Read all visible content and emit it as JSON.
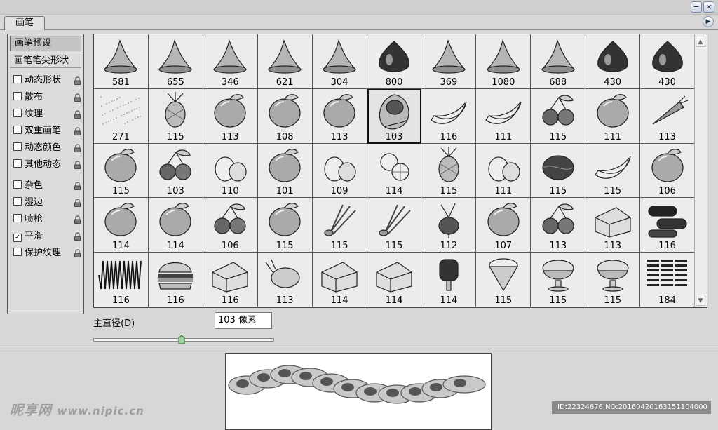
{
  "window": {
    "minimize_label": "−",
    "close_label": "×"
  },
  "tabs": [
    {
      "label": "画笔"
    }
  ],
  "panel_menu_icon": "arrow-right-icon",
  "left_panel": {
    "presets_label": "画笔预设",
    "tip_shape_label": "画笔笔尖形状",
    "options": [
      {
        "label": "动态形状",
        "checked": false,
        "lock": true
      },
      {
        "label": "散布",
        "checked": false,
        "lock": true
      },
      {
        "label": "纹理",
        "checked": false,
        "lock": true
      },
      {
        "label": "双重画笔",
        "checked": false,
        "lock": true
      },
      {
        "label": "动态颜色",
        "checked": false,
        "lock": true
      },
      {
        "label": "其他动态",
        "checked": false,
        "lock": true
      },
      {
        "label": "杂色",
        "checked": false,
        "lock": true
      },
      {
        "label": "湿边",
        "checked": false,
        "lock": true
      },
      {
        "label": "喷枪",
        "checked": false,
        "lock": true
      },
      {
        "label": "平滑",
        "checked": true,
        "lock": true
      },
      {
        "label": "保护纹理",
        "checked": false,
        "lock": true
      }
    ]
  },
  "brushes": [
    {
      "size": "581",
      "icon": "splash-icon"
    },
    {
      "size": "655",
      "icon": "splash-icon"
    },
    {
      "size": "346",
      "icon": "splash-icon"
    },
    {
      "size": "621",
      "icon": "splash-icon"
    },
    {
      "size": "304",
      "icon": "splash-icon"
    },
    {
      "size": "800",
      "icon": "drop-icon"
    },
    {
      "size": "369",
      "icon": "splash-icon"
    },
    {
      "size": "1080",
      "icon": "splash-icon"
    },
    {
      "size": "688",
      "icon": "splash-icon"
    },
    {
      "size": "430",
      "icon": "drop-icon"
    },
    {
      "size": "430",
      "icon": "drop-icon"
    },
    {
      "size": "271",
      "icon": "noise-icon"
    },
    {
      "size": "115",
      "icon": "pineapple-icon"
    },
    {
      "size": "113",
      "icon": "tomato-icon"
    },
    {
      "size": "108",
      "icon": "peach-icon"
    },
    {
      "size": "113",
      "icon": "plum-icon"
    },
    {
      "size": "103",
      "icon": "avocado-icon"
    },
    {
      "size": "116",
      "icon": "banana-icon"
    },
    {
      "size": "111",
      "icon": "peeled-banana-icon"
    },
    {
      "size": "115",
      "icon": "blackberry-icon"
    },
    {
      "size": "111",
      "icon": "cabbage-icon"
    },
    {
      "size": "113",
      "icon": "carrot-icon"
    },
    {
      "size": "115",
      "icon": "pepper-icon"
    },
    {
      "size": "103",
      "icon": "cherry-icon"
    },
    {
      "size": "110",
      "icon": "garlic-icon"
    },
    {
      "size": "101",
      "icon": "orange-icon"
    },
    {
      "size": "109",
      "icon": "eggs-icon"
    },
    {
      "size": "114",
      "icon": "citrus-slices-icon"
    },
    {
      "size": "115",
      "icon": "corn-icon"
    },
    {
      "size": "111",
      "icon": "mushroom-icon"
    },
    {
      "size": "115",
      "icon": "walnut-icon"
    },
    {
      "size": "115",
      "icon": "beans-icon"
    },
    {
      "size": "106",
      "icon": "apricot-icon"
    },
    {
      "size": "114",
      "icon": "pear-icon"
    },
    {
      "size": "114",
      "icon": "bell-pepper-icon"
    },
    {
      "size": "106",
      "icon": "plums-icon"
    },
    {
      "size": "115",
      "icon": "pumpkin-icon"
    },
    {
      "size": "115",
      "icon": "herb-icon"
    },
    {
      "size": "115",
      "icon": "scallion-icon"
    },
    {
      "size": "112",
      "icon": "radish-icon"
    },
    {
      "size": "107",
      "icon": "tomato-icon"
    },
    {
      "size": "113",
      "icon": "berries-icon"
    },
    {
      "size": "113",
      "icon": "bread-icon"
    },
    {
      "size": "116",
      "icon": "eclair-icon"
    },
    {
      "size": "116",
      "icon": "scribble-icon"
    },
    {
      "size": "116",
      "icon": "burger-icon"
    },
    {
      "size": "116",
      "icon": "cheese-icon"
    },
    {
      "size": "113",
      "icon": "chicken-icon"
    },
    {
      "size": "114",
      "icon": "cake-icon"
    },
    {
      "size": "114",
      "icon": "chocolate-icon"
    },
    {
      "size": "114",
      "icon": "popsicle-icon"
    },
    {
      "size": "115",
      "icon": "ice-cream-cone-icon"
    },
    {
      "size": "115",
      "icon": "sundae-icon"
    },
    {
      "size": "115",
      "icon": "pudding-icon"
    },
    {
      "size": "184",
      "icon": "text-texture-icon"
    }
  ],
  "selected_index": 16,
  "diameter": {
    "label": "主直径(D)",
    "value": "103 像素",
    "slider_fraction": 0.49
  },
  "watermark": {
    "brand": "昵享网",
    "url": "www.nipic.cn",
    "id_text": "ID:22324676 NO:20160420163151104000"
  }
}
